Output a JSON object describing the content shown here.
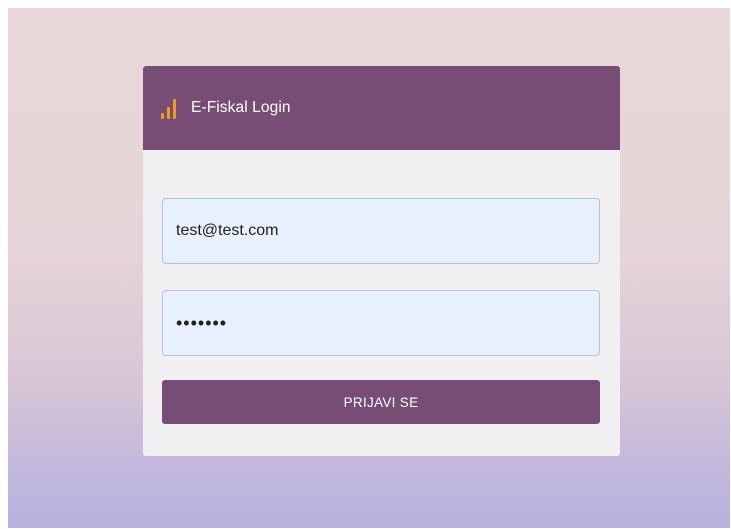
{
  "login": {
    "title": "E-Fiskal Login",
    "brand_icon": "bar-chart-icon",
    "email_value": "test@test.com",
    "password_value": "•••••••",
    "submit_label": "PRIJAVI SE"
  },
  "colors": {
    "header": "#774d76",
    "button": "#774d76",
    "icon": "#f39a1b",
    "input_bg": "#e8effd",
    "card_bg": "#f1eff1"
  }
}
